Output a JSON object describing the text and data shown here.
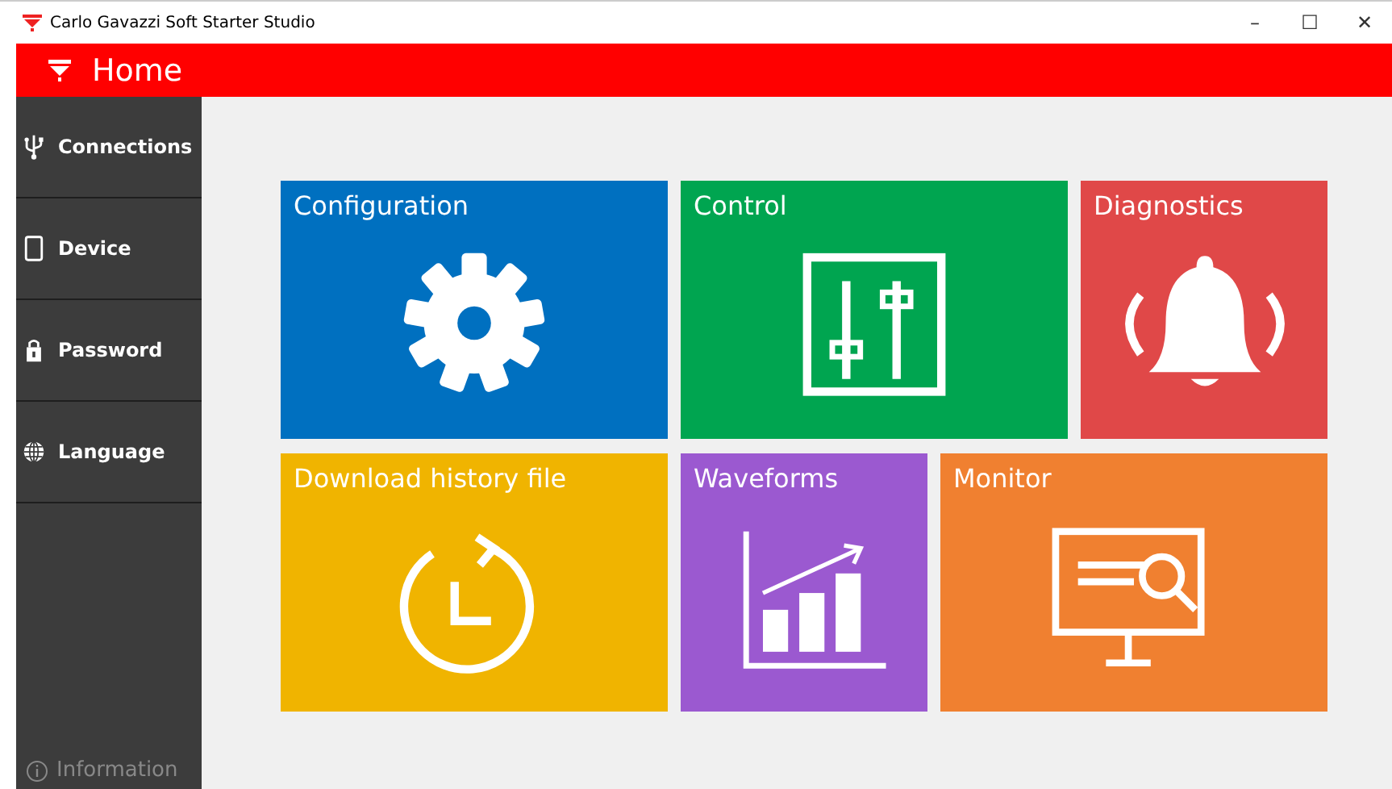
{
  "window": {
    "title": "Carlo Gavazzi Soft Starter Studio",
    "controls": [
      "–",
      "☐",
      "✕"
    ]
  },
  "header": {
    "title": "Home"
  },
  "sidebar": {
    "items": [
      {
        "label": "Connections"
      },
      {
        "label": "Device"
      },
      {
        "label": "Password"
      },
      {
        "label": "Language"
      }
    ],
    "footer": {
      "label": "Information"
    }
  },
  "tiles": [
    [
      {
        "label": "Configuration",
        "kind": "wide",
        "color": "#0070c0"
      },
      {
        "label": "Control",
        "kind": "wide",
        "color": "#00a550"
      },
      {
        "label": "Diagnostics",
        "kind": "narrow",
        "color": "#e04848"
      }
    ],
    [
      {
        "label": "Download history file",
        "kind": "wide",
        "color": "#f0b400"
      },
      {
        "label": "Waveforms",
        "kind": "narrow",
        "color": "#9b59d0"
      },
      {
        "label": "Monitor",
        "kind": "wide",
        "color": "#f08030"
      }
    ]
  ]
}
